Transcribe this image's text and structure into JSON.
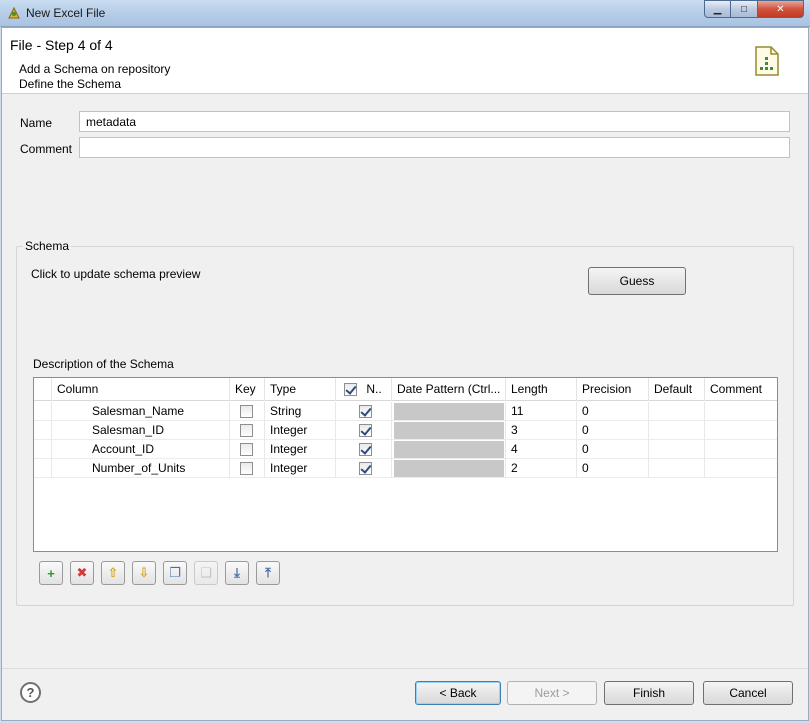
{
  "window": {
    "title": "New Excel File",
    "controls": {
      "minimize": "▁",
      "maximize": "□",
      "close": "✕"
    }
  },
  "header": {
    "step": "File - Step 4 of 4",
    "line1": "Add a Schema on repository",
    "line2": "Define the Schema",
    "icon": "excel-file-icon"
  },
  "form": {
    "name_label": "Name",
    "name_value": "metadata",
    "comment_label": "Comment",
    "comment_value": ""
  },
  "schema": {
    "group_title": "Schema",
    "preview_text": "Click to update schema preview",
    "guess_label": "Guess",
    "description_label": "Description of the Schema",
    "columns": [
      "Column",
      "Key",
      "Type",
      "N..",
      "Date Pattern (Ctrl...",
      "Length",
      "Precision",
      "Default",
      "Comment"
    ],
    "rows": [
      {
        "column": "Salesman_Name",
        "key": false,
        "type": "String",
        "nullable": true,
        "date_pattern": "",
        "length": "11",
        "precision": "0",
        "default": "",
        "comment": ""
      },
      {
        "column": "Salesman_ID",
        "key": false,
        "type": "Integer",
        "nullable": true,
        "date_pattern": "",
        "length": "3",
        "precision": "0",
        "default": "",
        "comment": ""
      },
      {
        "column": "Account_ID",
        "key": false,
        "type": "Integer",
        "nullable": true,
        "date_pattern": "",
        "length": "4",
        "precision": "0",
        "default": "",
        "comment": ""
      },
      {
        "column": "Number_of_Units",
        "key": false,
        "type": "Integer",
        "nullable": true,
        "date_pattern": "",
        "length": "2",
        "precision": "0",
        "default": "",
        "comment": ""
      }
    ],
    "toolbar": [
      {
        "name": "add-icon",
        "glyph": "+",
        "color": "#2f9a2f"
      },
      {
        "name": "delete-icon",
        "glyph": "✖",
        "color": "#d23a3a"
      },
      {
        "name": "move-up-icon",
        "glyph": "⇧",
        "color": "#d4a017"
      },
      {
        "name": "move-down-icon",
        "glyph": "⇩",
        "color": "#d4a017"
      },
      {
        "name": "copy-icon",
        "glyph": "❐",
        "color": "#4a6fa5"
      },
      {
        "name": "paste-icon",
        "glyph": "❏",
        "color": "#8c8c8c",
        "disabled": true
      },
      {
        "name": "import-icon",
        "glyph": "⤓",
        "color": "#4a6fa5"
      },
      {
        "name": "export-icon",
        "glyph": "⤒",
        "color": "#4a6fa5"
      }
    ]
  },
  "footer": {
    "help": "?",
    "back_label": "< Back",
    "next_label": "Next >",
    "finish_label": "Finish",
    "cancel_label": "Cancel"
  }
}
